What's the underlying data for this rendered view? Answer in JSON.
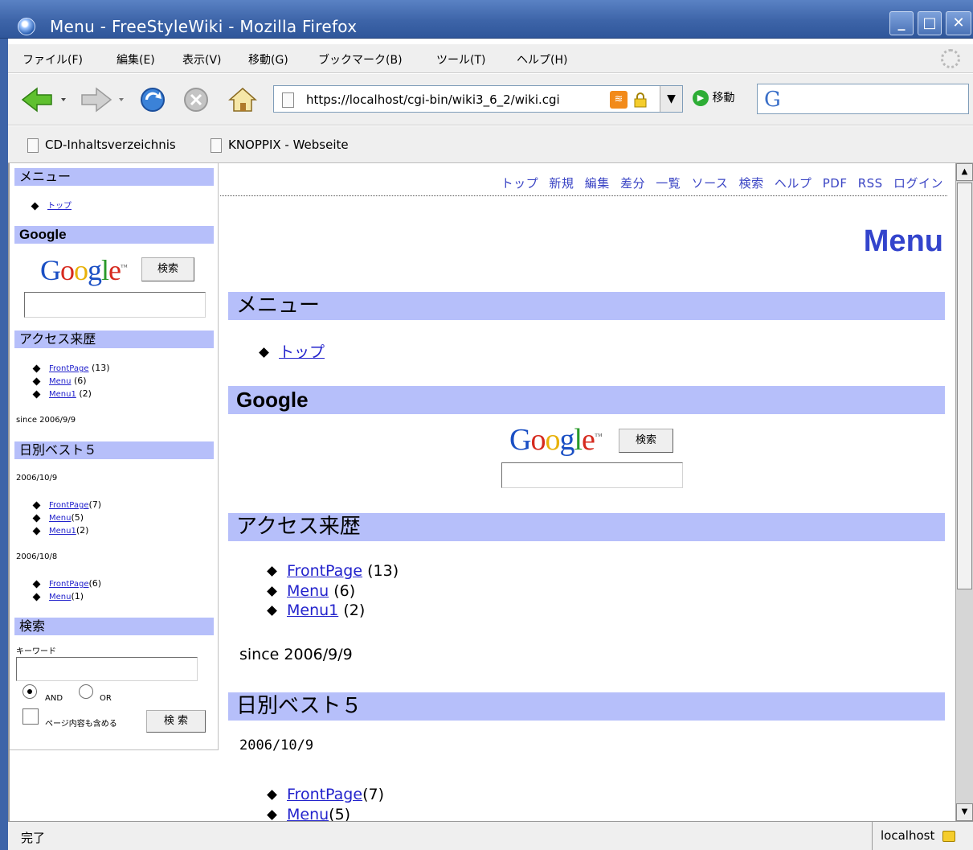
{
  "window": {
    "title": "Menu - FreeStyleWiki - Mozilla Firefox",
    "buttons": {
      "minimize": "_",
      "maximize": "□",
      "close": "✕"
    }
  },
  "menubar": {
    "items": [
      "ファイル(F)",
      "編集(E)",
      "表示(V)",
      "移動(G)",
      "ブックマーク(B)",
      "ツール(T)",
      "ヘルプ(H)"
    ]
  },
  "navbar": {
    "url": "https://localhost/cgi-bin/wiki3_6_2/wiki.cgi",
    "go_label": "移動",
    "search_value": ""
  },
  "bookmarks": [
    "CD-Inhaltsverzeichnis",
    "KNOPPIX - Webseite"
  ],
  "sidebar": {
    "menu_heading": "メニュー",
    "menu_items": [
      "トップ"
    ],
    "google_heading": "Google",
    "google_logo": "Google",
    "google_button": "検索",
    "access_heading": "アクセス来歴",
    "access_items": [
      {
        "link": "FrontPage",
        "count": "(13)"
      },
      {
        "link": "Menu",
        "count": "(6)"
      },
      {
        "link": "Menu1",
        "count": "(2)"
      }
    ],
    "since": "since 2006/9/9",
    "best_heading": "日別ベスト５",
    "day1": "2006/10/9",
    "day1_items": [
      {
        "link": "FrontPage",
        "count": "(7)"
      },
      {
        "link": "Menu",
        "count": "(5)"
      },
      {
        "link": "Menu1",
        "count": "(2)"
      }
    ],
    "day2": "2006/10/8",
    "day2_items": [
      {
        "link": "FrontPage",
        "count": "(6)"
      },
      {
        "link": "Menu",
        "count": "(1)"
      }
    ],
    "search_heading": "検索",
    "keyword_label": "キーワード",
    "and_label": "AND",
    "or_label": "OR",
    "include_label": "ページ内容も含める",
    "search_button": "検 索"
  },
  "main": {
    "topnav": [
      "トップ",
      "新規",
      "編集",
      "差分",
      "一覧",
      "ソース",
      "検索",
      "ヘルプ",
      "PDF",
      "RSS",
      "ログイン"
    ],
    "page_title": "Menu",
    "menu_heading": "メニュー",
    "menu_items": [
      "トップ"
    ],
    "google_heading": "Google",
    "google_logo": "Google",
    "google_button": "検索",
    "access_heading": "アクセス来歴",
    "access_items": [
      {
        "link": "FrontPage",
        "count": "(13)"
      },
      {
        "link": "Menu",
        "count": "(6)"
      },
      {
        "link": "Menu1",
        "count": "(2)"
      }
    ],
    "since": "since 2006/9/9",
    "best_heading": "日別ベスト５",
    "day1": "2006/10/9",
    "day1_items": [
      {
        "link": "FrontPage",
        "count": "(7)"
      },
      {
        "link": "Menu",
        "count": "(5)"
      }
    ]
  },
  "statusbar": {
    "status": "完了",
    "host": "localhost"
  },
  "colors": {
    "heading_bg": "#b6bffa",
    "link": "#2222cc",
    "title_blue": "#3344cc",
    "titlebar": "#3d64a8"
  }
}
